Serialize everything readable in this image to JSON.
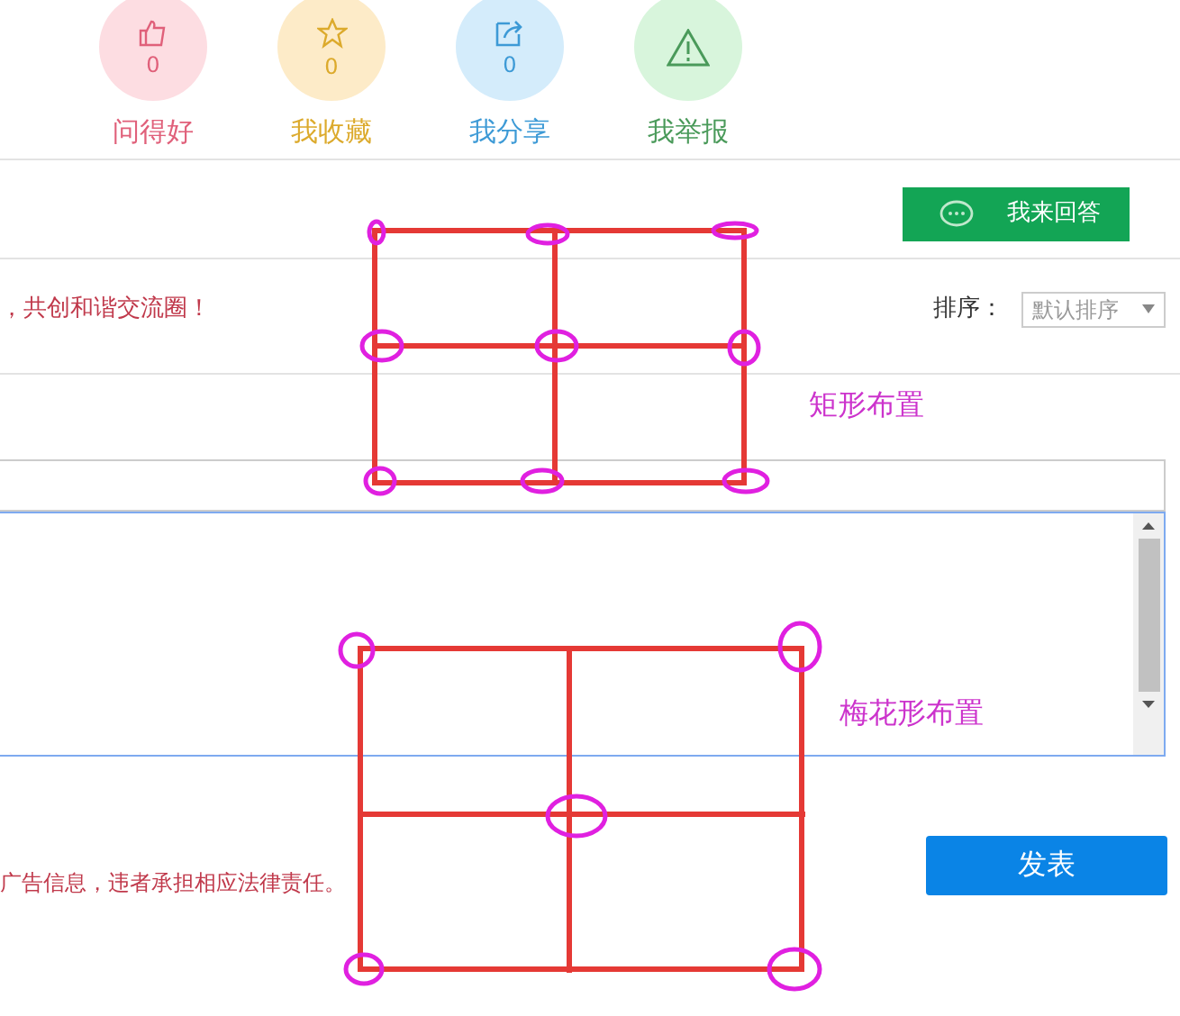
{
  "stats": [
    {
      "kind": "thumbs-up",
      "count": "0",
      "label": "问得好",
      "color": "#e0607a"
    },
    {
      "kind": "star",
      "count": "0",
      "label": "我收藏",
      "color": "#dcaa2c"
    },
    {
      "kind": "share",
      "count": "0",
      "label": "我分享",
      "color": "#3d9ad6"
    },
    {
      "kind": "warning",
      "label": "我举报",
      "color": "#4a9a5a"
    }
  ],
  "answer_button": "我来回答",
  "notice": "，共创和谐交流圈！",
  "sort": {
    "label": "排序：",
    "value": "默认排序"
  },
  "legal_notice": "广告信息，违者承担相应法律责任。",
  "submit_button": "发表",
  "annotations": [
    {
      "kind": "rectangular",
      "label": "矩形布置"
    },
    {
      "kind": "quincunx",
      "label": "梅花形布置"
    }
  ]
}
